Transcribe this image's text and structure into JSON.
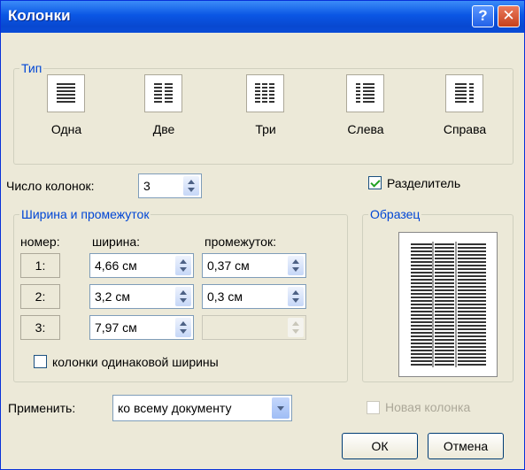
{
  "window": {
    "title": "Колонки",
    "help_label": "?",
    "close_label": "✕"
  },
  "type_group": {
    "legend": "Тип",
    "options": [
      {
        "label": "Одна",
        "icon": "one-column-icon"
      },
      {
        "label": "Две",
        "icon": "two-columns-icon"
      },
      {
        "label": "Три",
        "icon": "three-columns-icon"
      },
      {
        "label": "Слева",
        "icon": "left-columns-icon"
      },
      {
        "label": "Справа",
        "icon": "right-columns-icon"
      }
    ]
  },
  "column_count": {
    "label": "Число колонок:",
    "value": "3"
  },
  "separator": {
    "label": "Разделитель",
    "checked": true
  },
  "width_group": {
    "legend": "Ширина и промежуток",
    "headers": {
      "number": "номер:",
      "width": "ширина:",
      "spacing": "промежуток:"
    },
    "rows": [
      {
        "number": "1:",
        "width": "4,66 см",
        "spacing": "0,37 см"
      },
      {
        "number": "2:",
        "width": "3,2 см",
        "spacing": "0,3 см"
      },
      {
        "number": "3:",
        "width": "7,97 см",
        "spacing": ""
      }
    ],
    "equal_width": {
      "label": "колонки одинаковой ширины",
      "checked": false
    }
  },
  "preview": {
    "legend": "Образец"
  },
  "apply": {
    "label": "Применить:",
    "value": "ко всему документу"
  },
  "new_column": {
    "label": "Новая колонка",
    "checked": false
  },
  "buttons": {
    "ok": "ОК",
    "cancel": "Отмена"
  }
}
